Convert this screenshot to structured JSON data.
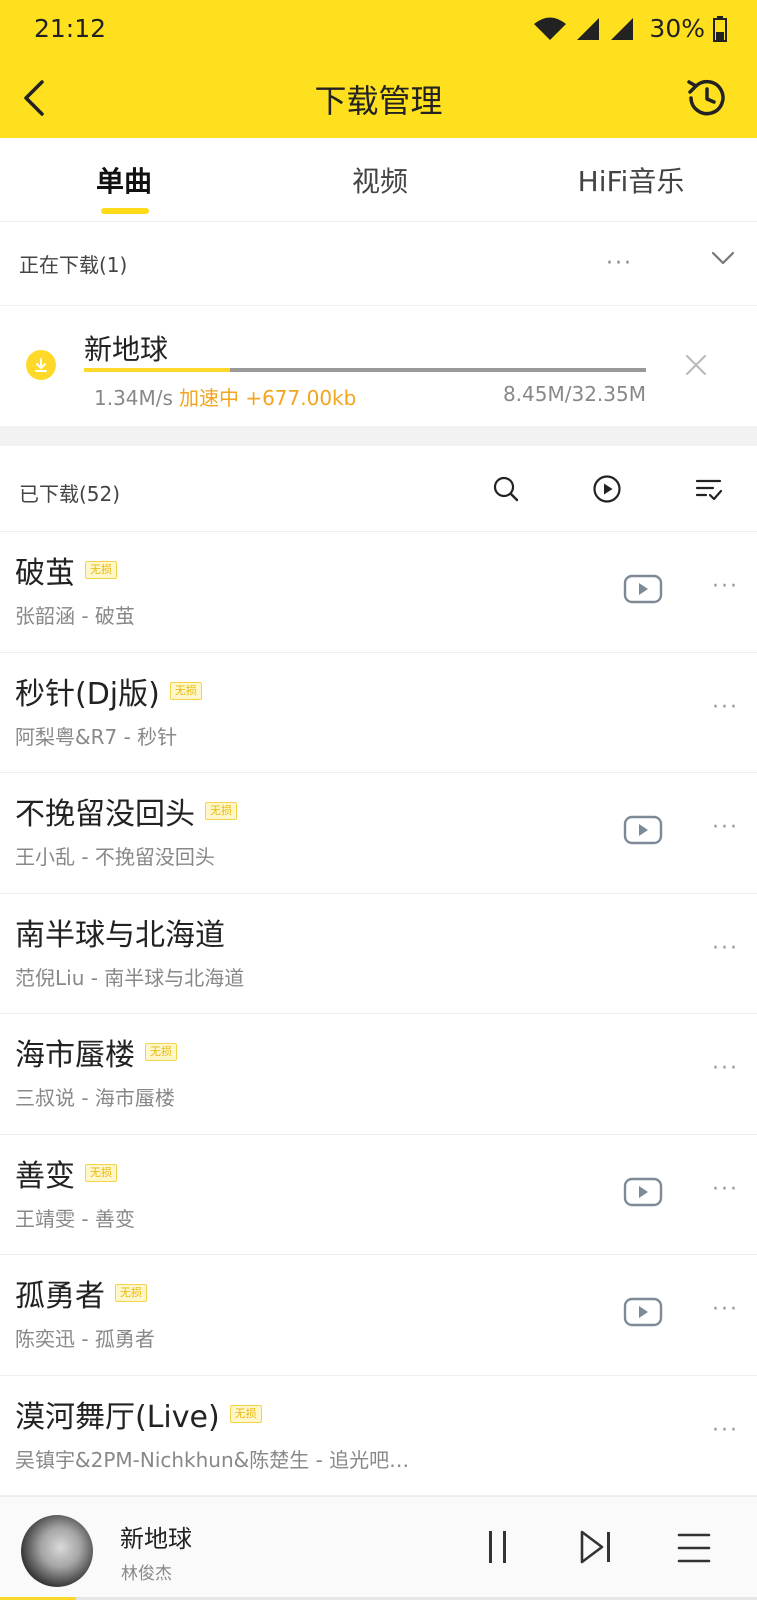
{
  "status_bar": {
    "time": "21:12",
    "battery": "30%",
    "icons": [
      "wifi-icon",
      "signal-icon",
      "signal-icon",
      "battery-icon"
    ]
  },
  "header": {
    "title": "下载管理",
    "back_icon": "back-arrow-icon",
    "history_icon": "history-clock-icon"
  },
  "tabs": [
    {
      "label": "单曲",
      "active": true
    },
    {
      "label": "视频",
      "active": false
    },
    {
      "label": "HiFi音乐",
      "active": false
    }
  ],
  "downloading": {
    "header": "正在下载(1)",
    "more": "···",
    "item": {
      "name": "新地球",
      "speed": "1.34M/s",
      "accel_label": "加速中 +677.00kb",
      "size": "8.45M/32.35M",
      "progress": 0.26
    }
  },
  "downloaded": {
    "header": "已下载(52)",
    "tools": [
      "search-icon",
      "play-circle-icon",
      "sort-list-icon"
    ],
    "lossless_label": "无损",
    "more": "···",
    "songs": [
      {
        "title": "破茧",
        "subtitle": "张韶涵 - 破茧",
        "lossless": true,
        "mv": true
      },
      {
        "title": "秒针(Dj版)",
        "subtitle": "阿梨粤&R7 - 秒针",
        "lossless": true,
        "mv": false
      },
      {
        "title": "不挽留没回头",
        "subtitle": "王小乱 - 不挽留没回头",
        "lossless": true,
        "mv": true
      },
      {
        "title": "南半球与北海道",
        "subtitle": "范倪Liu - 南半球与北海道",
        "lossless": false,
        "mv": false
      },
      {
        "title": "海市蜃楼",
        "subtitle": "三叔说 - 海市蜃楼",
        "lossless": true,
        "mv": false
      },
      {
        "title": "善变",
        "subtitle": "王靖雯 - 善变",
        "lossless": true,
        "mv": true
      },
      {
        "title": "孤勇者",
        "subtitle": "陈奕迅 - 孤勇者",
        "lossless": true,
        "mv": true
      },
      {
        "title": "漠河舞厅(Live)",
        "subtitle": "吴镇宇&2PM-Nichkhun&陈楚生 - 追光吧…",
        "lossless": true,
        "mv": false
      }
    ]
  },
  "player": {
    "title": "新地球",
    "artist": "林俊杰",
    "progress": 0.1
  },
  "colors": {
    "brand_yellow": "#FFE01E",
    "accent_orange": "#F2A51E",
    "progress_yellow": "#FFD92A"
  }
}
